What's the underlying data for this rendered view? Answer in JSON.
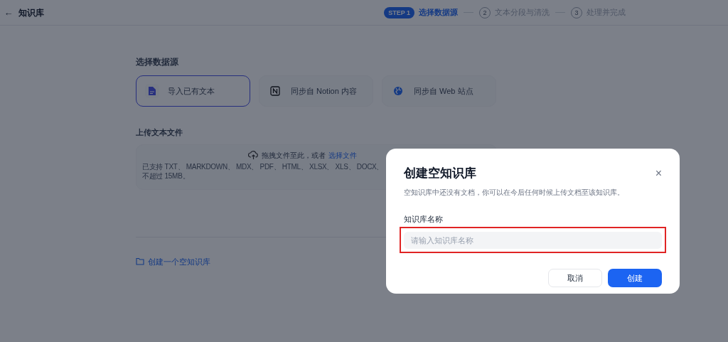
{
  "header": {
    "back_icon": "←",
    "title": "知识库"
  },
  "steps": [
    {
      "badge": "STEP 1",
      "label": "选择数据源",
      "selected": true
    },
    {
      "badge": "2",
      "label": "文本分段与清洗",
      "selected": false
    },
    {
      "badge": "3",
      "label": "处理并完成",
      "selected": false
    }
  ],
  "source": {
    "heading": "选择数据源",
    "options": [
      {
        "kind": "file",
        "label": "导入已有文本",
        "selected": true
      },
      {
        "kind": "notion",
        "label": "同步自 Notion 内容",
        "selected": false
      },
      {
        "kind": "web",
        "label": "同步自 Web 站点",
        "selected": false
      }
    ]
  },
  "upload": {
    "heading": "上传文本文件",
    "drop_text": "拖拽文件至此，或者",
    "link": "选择文件",
    "hint_lines": [
      "已支持 TXT、 MARKDOWN、 MDX、 PDF、 HTML、 XLSX、 XLS、 DOCX、",
      "不超过 15MB。"
    ]
  },
  "create_empty_link": "创建一个空知识库",
  "dialog": {
    "title": "创建空知识库",
    "close": "×",
    "description": "空知识库中还没有文档，你可以在今后任何时候上传文档至该知识库。",
    "field_label": "知识库名称",
    "placeholder": "请输入知识库名称",
    "highlighted": true,
    "buttons": [
      {
        "kind": "secondary",
        "label": "取消"
      },
      {
        "kind": "primary",
        "label": "创建"
      }
    ]
  }
}
